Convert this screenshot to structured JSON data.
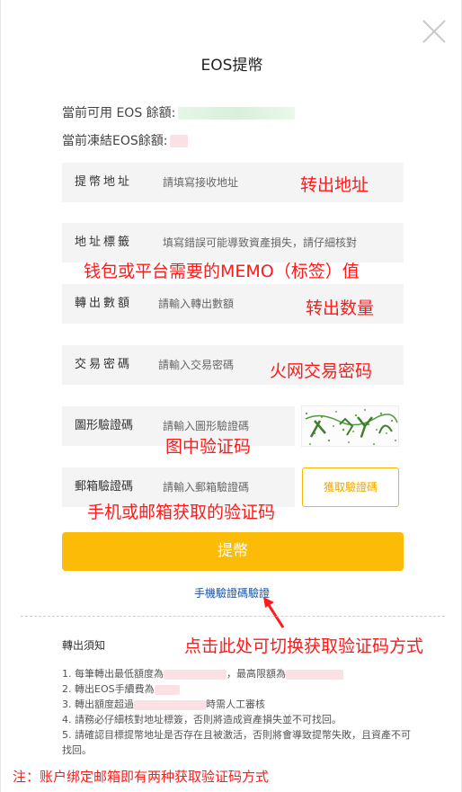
{
  "dialog": {
    "title": "EOS提幣",
    "available_label": "當前可用 EOS 餘額:",
    "frozen_label": "當前凍結EOS餘額:"
  },
  "form": {
    "address": {
      "label": "提幣地址",
      "placeholder": "請填寫接收地址"
    },
    "memo": {
      "label": "地址標籤",
      "placeholder": "填寫錯誤可能導致資產損失，請仔細核對"
    },
    "amount": {
      "label": "轉出數額",
      "placeholder": "請輸入轉出數額"
    },
    "password": {
      "label": "交易密碼",
      "placeholder": "請輸入交易密碼"
    },
    "image_captcha": {
      "label": "圖形驗證碼",
      "placeholder": "請輸入圖形驗證碼"
    },
    "email_code": {
      "label": "郵箱驗證碼",
      "placeholder": "請輸入郵箱驗證碼"
    },
    "get_code_label": "獲取驗證碼",
    "submit_label": "提幣",
    "phone_verify_link": "手機驗證碼驗證"
  },
  "notice": {
    "title": "轉出須知",
    "items": [
      {
        "a": "1. 每筆轉出最低額度為",
        "b": "，最高限額為"
      },
      {
        "a": "2. 轉出EOS手續費為"
      },
      {
        "a": "3. 轉出額度超過",
        "b": "時需人工審核"
      },
      {
        "a": "4. 請務必仔細核對地址標簽，否則將造成資產損失並不可找回。"
      },
      {
        "a": "5. 請確認目標提幣地址是否存在且被激活，否則將會導致提幣失敗，且資產不可找回。"
      }
    ]
  },
  "annotations": {
    "address": "转出地址",
    "memo": "钱包或平台需要的MEMO（标签）值",
    "amount": "转出数量",
    "password": "火网交易密码",
    "captcha": "图中验证码",
    "email_code": "手机或邮箱获取的验证码",
    "switch_method": "点击此处可切换获取验证码方式",
    "footnote": "注：账户绑定邮箱即有两种获取验证码方式"
  },
  "colors": {
    "accent": "#fbbb07",
    "annotation": "#ff1a1a",
    "link": "#1a4fa0"
  }
}
